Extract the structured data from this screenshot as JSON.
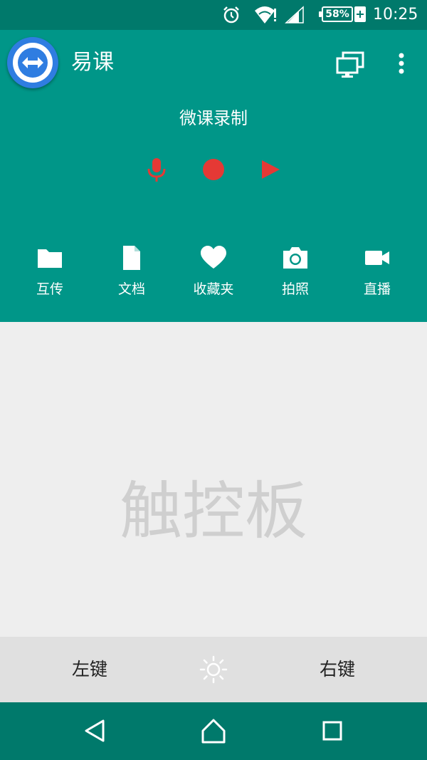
{
  "status_bar": {
    "battery_percent": "58%",
    "time": "10:25",
    "icons": [
      "alarm-icon",
      "wifi-icon",
      "signal-icon",
      "battery-icon",
      "charging-icon"
    ]
  },
  "app": {
    "title": "易课",
    "logo_icon": "teamviewer-arrows-icon",
    "toolbar_icons": [
      "monitor-icon",
      "more-vert-icon"
    ]
  },
  "recording": {
    "title": "微课录制",
    "controls": [
      {
        "icon": "microphone-icon",
        "color": "#e53935"
      },
      {
        "icon": "record-dot-icon",
        "color": "#e53935"
      },
      {
        "icon": "play-icon",
        "color": "#e53935"
      }
    ]
  },
  "actions": [
    {
      "label": "互传",
      "icon": "folder-icon"
    },
    {
      "label": "文档",
      "icon": "document-icon"
    },
    {
      "label": "收藏夹",
      "icon": "heart-icon"
    },
    {
      "label": "拍照",
      "icon": "camera-icon"
    },
    {
      "label": "直播",
      "icon": "video-camera-icon"
    }
  ],
  "touchpad": {
    "label": "触控板"
  },
  "mouse_bar": {
    "left_key": "左键",
    "right_key": "右键",
    "center_icon": "brightness-icon"
  },
  "nav_bar": {
    "icons": [
      "back-icon",
      "home-icon",
      "recents-icon"
    ]
  },
  "colors": {
    "primary": "#009688",
    "primary_dark": "#00796b",
    "accent_red": "#e53935",
    "logo_blue": "#2f7de1"
  }
}
